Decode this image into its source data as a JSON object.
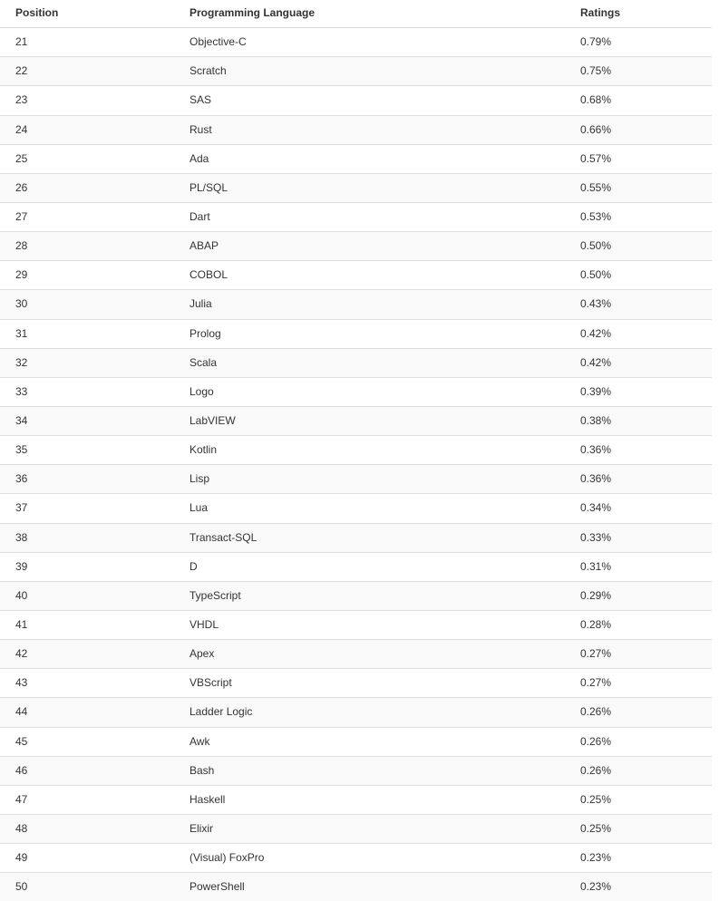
{
  "table": {
    "name": "programming-language-ranking",
    "columns": [
      {
        "key": "position",
        "label": "Position",
        "align": "left"
      },
      {
        "key": "language",
        "label": "Programming Language",
        "align": "left"
      },
      {
        "key": "ratings",
        "label": "Ratings",
        "align": "left"
      }
    ],
    "rows": [
      {
        "position": "21",
        "language": "Objective-C",
        "ratings": "0.79%"
      },
      {
        "position": "22",
        "language": "Scratch",
        "ratings": "0.75%"
      },
      {
        "position": "23",
        "language": "SAS",
        "ratings": "0.68%"
      },
      {
        "position": "24",
        "language": "Rust",
        "ratings": "0.66%"
      },
      {
        "position": "25",
        "language": "Ada",
        "ratings": "0.57%"
      },
      {
        "position": "26",
        "language": "PL/SQL",
        "ratings": "0.55%"
      },
      {
        "position": "27",
        "language": "Dart",
        "ratings": "0.53%"
      },
      {
        "position": "28",
        "language": "ABAP",
        "ratings": "0.50%"
      },
      {
        "position": "29",
        "language": "COBOL",
        "ratings": "0.50%"
      },
      {
        "position": "30",
        "language": "Julia",
        "ratings": "0.43%"
      },
      {
        "position": "31",
        "language": "Prolog",
        "ratings": "0.42%"
      },
      {
        "position": "32",
        "language": "Scala",
        "ratings": "0.42%"
      },
      {
        "position": "33",
        "language": "Logo",
        "ratings": "0.39%"
      },
      {
        "position": "34",
        "language": "LabVIEW",
        "ratings": "0.38%"
      },
      {
        "position": "35",
        "language": "Kotlin",
        "ratings": "0.36%"
      },
      {
        "position": "36",
        "language": "Lisp",
        "ratings": "0.36%"
      },
      {
        "position": "37",
        "language": "Lua",
        "ratings": "0.34%"
      },
      {
        "position": "38",
        "language": "Transact-SQL",
        "ratings": "0.33%"
      },
      {
        "position": "39",
        "language": "D",
        "ratings": "0.31%"
      },
      {
        "position": "40",
        "language": "TypeScript",
        "ratings": "0.29%"
      },
      {
        "position": "41",
        "language": "VHDL",
        "ratings": "0.28%"
      },
      {
        "position": "42",
        "language": "Apex",
        "ratings": "0.27%"
      },
      {
        "position": "43",
        "language": "VBScript",
        "ratings": "0.27%"
      },
      {
        "position": "44",
        "language": "Ladder Logic",
        "ratings": "0.26%"
      },
      {
        "position": "45",
        "language": "Awk",
        "ratings": "0.26%"
      },
      {
        "position": "46",
        "language": "Bash",
        "ratings": "0.26%"
      },
      {
        "position": "47",
        "language": "Haskell",
        "ratings": "0.25%"
      },
      {
        "position": "48",
        "language": "Elixir",
        "ratings": "0.25%"
      },
      {
        "position": "49",
        "language": "(Visual) FoxPro",
        "ratings": "0.23%"
      },
      {
        "position": "50",
        "language": "PowerShell",
        "ratings": "0.23%"
      }
    ]
  },
  "colors": {
    "text": "#333333",
    "row_stripe": "#f9f9f9",
    "row_base": "#ffffff",
    "border": "#dddddd",
    "page_background": "#ffffff"
  }
}
